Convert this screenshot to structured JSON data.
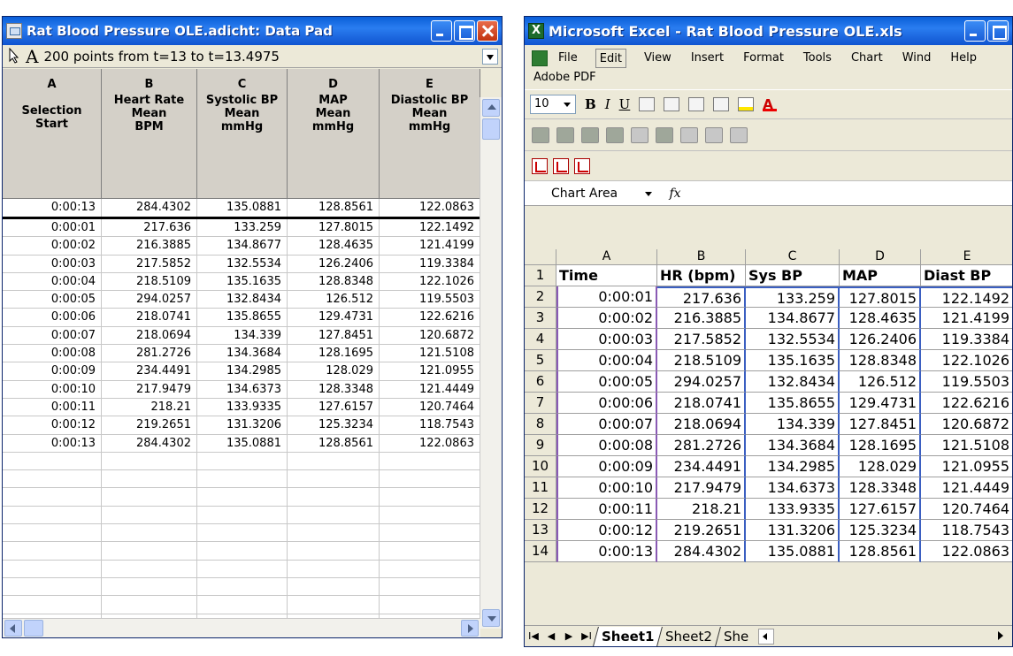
{
  "datapad": {
    "title": "Rat Blood Pressure OLE.adicht: Data Pad",
    "range_text": "200 points from t=13 to t=13.4975",
    "font_tool_label": "A",
    "columns": [
      {
        "letter": "A",
        "l1": "Selection",
        "l2": "Start",
        "l3": ""
      },
      {
        "letter": "B",
        "l1": "Heart Rate",
        "l2": "Mean",
        "l3": "BPM"
      },
      {
        "letter": "C",
        "l1": "Systolic BP",
        "l2": "Mean",
        "l3": "mmHg"
      },
      {
        "letter": "D",
        "l1": "MAP",
        "l2": "Mean",
        "l3": "mmHg"
      },
      {
        "letter": "E",
        "l1": "Diastolic BP",
        "l2": "Mean",
        "l3": "mmHg"
      }
    ],
    "rows": [
      [
        "0:00:13",
        "284.4302",
        "135.0881",
        "128.8561",
        "122.0863"
      ],
      [
        "0:00:01",
        "217.636",
        "133.259",
        "127.8015",
        "122.1492"
      ],
      [
        "0:00:02",
        "216.3885",
        "134.8677",
        "128.4635",
        "121.4199"
      ],
      [
        "0:00:03",
        "217.5852",
        "132.5534",
        "126.2406",
        "119.3384"
      ],
      [
        "0:00:04",
        "218.5109",
        "135.1635",
        "128.8348",
        "122.1026"
      ],
      [
        "0:00:05",
        "294.0257",
        "132.8434",
        "126.512",
        "119.5503"
      ],
      [
        "0:00:06",
        "218.0741",
        "135.8655",
        "129.4731",
        "122.6216"
      ],
      [
        "0:00:07",
        "218.0694",
        "134.339",
        "127.8451",
        "120.6872"
      ],
      [
        "0:00:08",
        "281.2726",
        "134.3684",
        "128.1695",
        "121.5108"
      ],
      [
        "0:00:09",
        "234.4491",
        "134.2985",
        "128.029",
        "121.0955"
      ],
      [
        "0:00:10",
        "217.9479",
        "134.6373",
        "128.3348",
        "121.4449"
      ],
      [
        "0:00:11",
        "218.21",
        "133.9335",
        "127.6157",
        "120.7464"
      ],
      [
        "0:00:12",
        "219.2651",
        "131.3206",
        "125.3234",
        "118.7543"
      ],
      [
        "0:00:13",
        "284.4302",
        "135.0881",
        "128.8561",
        "122.0863"
      ]
    ],
    "empty_rows": 11
  },
  "excel": {
    "title": "Microsoft Excel - Rat Blood Pressure OLE.xls",
    "menu": [
      "File",
      "Edit",
      "View",
      "Insert",
      "Format",
      "Tools",
      "Chart",
      "Wind"
    ],
    "menu2": [
      "Help",
      "Adobe PDF"
    ],
    "font_size": "10",
    "bold_label": "B",
    "italic_label": "I",
    "underline_label": "U",
    "font_color_label": "A",
    "name_box": "Chart Area",
    "fx_label": "fx",
    "col_headers": [
      "A",
      "B",
      "C",
      "D",
      "E"
    ],
    "header_row": [
      "Time",
      "HR (bpm)",
      "Sys BP",
      "MAP",
      "Diast BP"
    ],
    "rows": [
      [
        "0:00:01",
        "217.636",
        "133.259",
        "127.8015",
        "122.1492"
      ],
      [
        "0:00:02",
        "216.3885",
        "134.8677",
        "128.4635",
        "121.4199"
      ],
      [
        "0:00:03",
        "217.5852",
        "132.5534",
        "126.2406",
        "119.3384"
      ],
      [
        "0:00:04",
        "218.5109",
        "135.1635",
        "128.8348",
        "122.1026"
      ],
      [
        "0:00:05",
        "294.0257",
        "132.8434",
        "126.512",
        "119.5503"
      ],
      [
        "0:00:06",
        "218.0741",
        "135.8655",
        "129.4731",
        "122.6216"
      ],
      [
        "0:00:07",
        "218.0694",
        "134.339",
        "127.8451",
        "120.6872"
      ],
      [
        "0:00:08",
        "281.2726",
        "134.3684",
        "128.1695",
        "121.5108"
      ],
      [
        "0:00:09",
        "234.4491",
        "134.2985",
        "128.029",
        "121.0955"
      ],
      [
        "0:00:10",
        "217.9479",
        "134.6373",
        "128.3348",
        "121.4449"
      ],
      [
        "0:00:11",
        "218.21",
        "133.9335",
        "127.6157",
        "120.7464"
      ],
      [
        "0:00:12",
        "219.2651",
        "131.3206",
        "125.3234",
        "118.7543"
      ],
      [
        "0:00:13",
        "284.4302",
        "135.0881",
        "128.8561",
        "122.0863"
      ]
    ],
    "row_numbers": [
      "1",
      "2",
      "3",
      "4",
      "5",
      "6",
      "7",
      "8",
      "9",
      "10",
      "11",
      "12",
      "13",
      "14"
    ],
    "sheets": [
      "Sheet1",
      "Sheet2",
      "She"
    ],
    "active_sheet": "Sheet1",
    "win_ctrl_label": "_ ▫"
  }
}
